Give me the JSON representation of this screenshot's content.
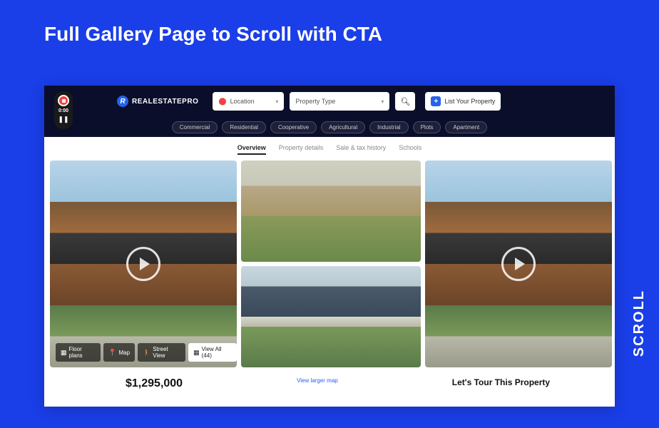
{
  "slide_title": "Full Gallery Page to Scroll with CTA",
  "scroll_label": "SCROLL",
  "logo": {
    "badge": "R",
    "text": "REALESTATEPRO"
  },
  "search": {
    "location_placeholder": "Location",
    "property_type_placeholder": "Property Type"
  },
  "list_button": "List Your Property",
  "categories": [
    "Commercial",
    "Residential",
    "Cooperative",
    "Agricultural",
    "Industrial",
    "Plots",
    "Apartment"
  ],
  "tabs": [
    {
      "label": "Overview",
      "active": true
    },
    {
      "label": "Property details",
      "active": false
    },
    {
      "label": "Sale & tax history",
      "active": false
    },
    {
      "label": "Schools",
      "active": false
    }
  ],
  "recorder": {
    "time": "0:00"
  },
  "gallery_tools": {
    "floor_plans": "Floor plans",
    "map": "Map",
    "street_view": "Street View",
    "view_all": "View All (44)"
  },
  "below": {
    "price": "$1,295,000",
    "map_link": "View larger map",
    "tour_heading": "Let's Tour This Property"
  }
}
